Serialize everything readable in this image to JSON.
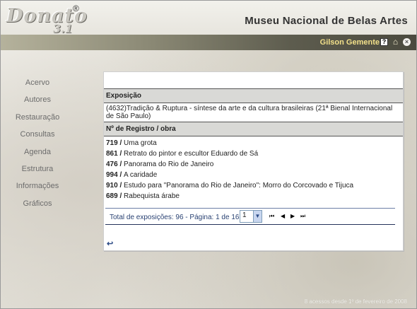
{
  "header": {
    "logo_word": "Donato",
    "logo_version": "3.1",
    "logo_reg": "®",
    "site_title": "Museu Nacional de Belas Artes"
  },
  "userbar": {
    "user_name": "Gilson Gemente",
    "help_glyph": "?",
    "home_glyph": "⌂",
    "close_glyph": "×",
    "icons": [
      "help-icon",
      "home-icon",
      "close-icon"
    ]
  },
  "sidebar": {
    "items": [
      {
        "label": "Acervo"
      },
      {
        "label": "Autores"
      },
      {
        "label": "Restauração"
      },
      {
        "label": "Consultas"
      },
      {
        "label": "Agenda"
      },
      {
        "label": "Estrutura"
      },
      {
        "label": "Informações"
      },
      {
        "label": "Gráficos"
      }
    ]
  },
  "main": {
    "expo_header": "Exposição",
    "expo_text": "(4632)Tradição & Ruptura - síntese da arte e da cultura brasileiras (21ª Bienal Internacional de São Paulo)",
    "registro_header": "Nº de Registro / obra",
    "rows": [
      {
        "num": "719",
        "title": "Uma grota"
      },
      {
        "num": "861",
        "title": "Retrato do pintor e escultor Eduardo de Sá"
      },
      {
        "num": "476",
        "title": "Panorama do Rio de Janeiro"
      },
      {
        "num": "994",
        "title": "A caridade"
      },
      {
        "num": "910",
        "title": "Estudo para \"Panorama do Rio de Janeiro\": Morro do Corcovado e Tijuca"
      },
      {
        "num": "689",
        "title": "Rabequista árabe"
      }
    ],
    "separator": " / "
  },
  "pager": {
    "total_text": "Total de exposições: 96 - Página: 1 de 16",
    "selected_page": "1",
    "first_glyph": "⏮",
    "prev_glyph": "◀",
    "next_glyph": "▶",
    "last_glyph": "⏭",
    "dropdown_glyph": "▼"
  },
  "back_glyph": "↩",
  "footer": {
    "text": "8 acessos desde 1º de fevereiro de 2008"
  },
  "colors": {
    "userbar_text": "#f2e08a",
    "pager_text": "#2a4273"
  }
}
